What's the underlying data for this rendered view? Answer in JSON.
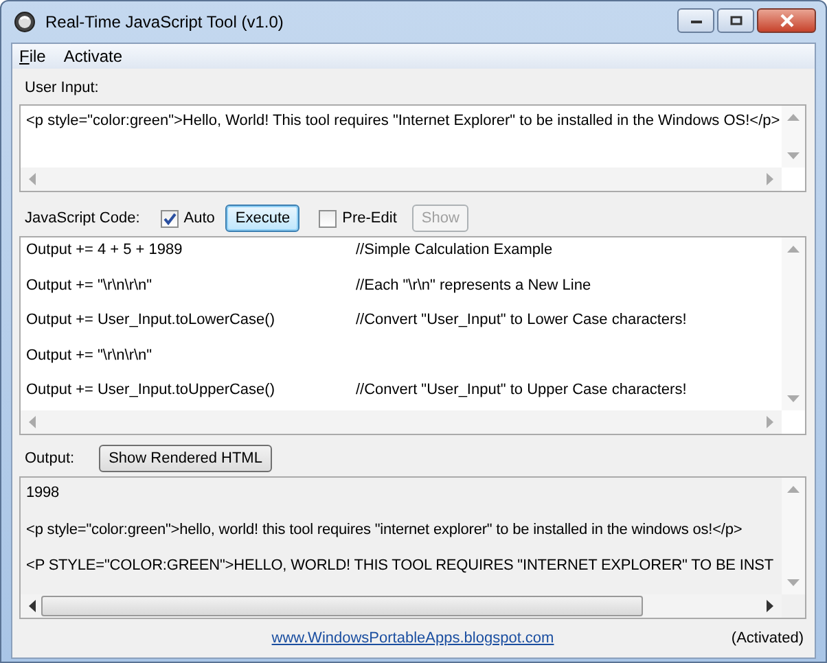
{
  "window": {
    "title": "Real-Time JavaScript Tool (v1.0)"
  },
  "menu": [
    {
      "label": "File"
    },
    {
      "label": "Activate"
    }
  ],
  "user_input": {
    "label": "User Input:",
    "value": "<p style=\"color:green\">Hello, World! This tool requires \"Internet Explorer\" to be installed in the Windows OS!</p>"
  },
  "code": {
    "label": "JavaScript Code:",
    "auto": {
      "label": "Auto",
      "checked": true
    },
    "execute": {
      "label": "Execute",
      "focused": true
    },
    "pre_edit": {
      "label": "Pre-Edit",
      "checked": false
    },
    "show": {
      "label": "Show",
      "disabled": true
    },
    "lines": [
      {
        "code": "Output += 4 + 5 + 1989",
        "comment": "//Simple Calculation Example"
      },
      {
        "code": "Output += \"\\r\\n\\r\\n\"",
        "comment": "//Each \"\\r\\n\" represents a New Line"
      },
      {
        "code": "Output += User_Input.toLowerCase()",
        "comment": "//Convert \"User_Input\" to Lower Case characters!"
      },
      {
        "code": "Output += \"\\r\\n\\r\\n\""
      },
      {
        "code": "Output += User_Input.toUpperCase()",
        "comment": "//Convert \"User_Input\" to Upper Case characters!"
      }
    ]
  },
  "output": {
    "label": "Output:",
    "button": "Show Rendered HTML",
    "lines": [
      "1998",
      "<p style=\"color:green\">hello, world! this tool requires \"internet explorer\" to be installed in the windows os!</p>",
      "<P STYLE=\"COLOR:GREEN\">HELLO, WORLD! THIS TOOL REQUIRES \"INTERNET EXPLORER\" TO BE INST"
    ]
  },
  "footer": {
    "link": "www.WindowsPortableApps.blogspot.com",
    "status": "(Activated)"
  }
}
